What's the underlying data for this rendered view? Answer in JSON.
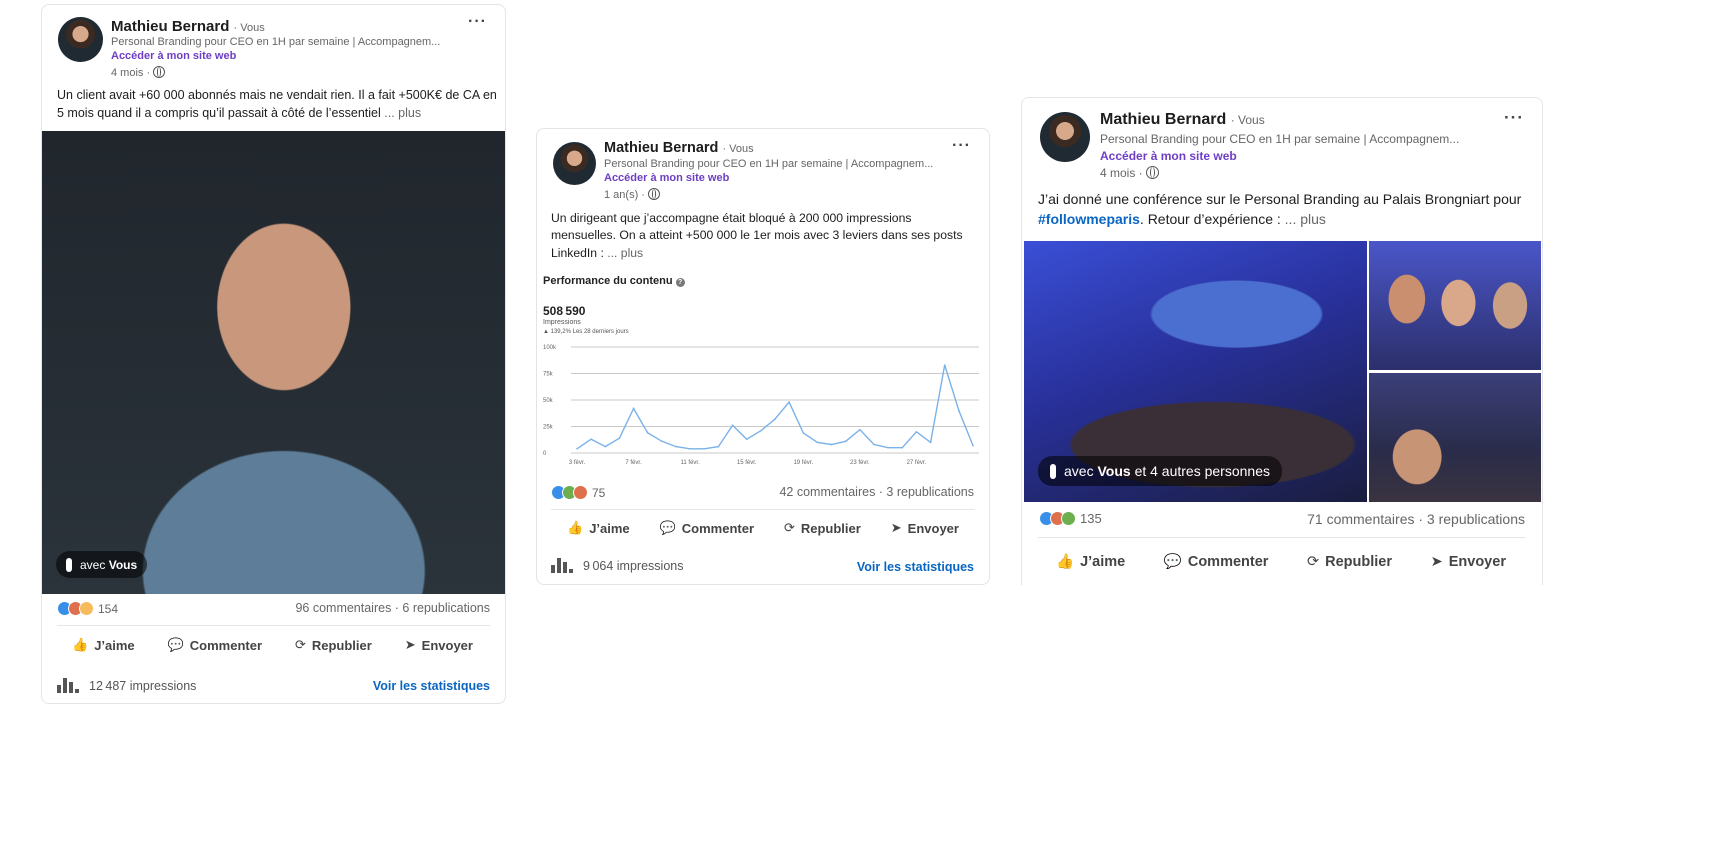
{
  "author": {
    "name": "Mathieu Bernard",
    "badge": "· Vous",
    "headline": "Personal Branding pour CEO en 1H par semaine | Accompagnem...",
    "website_link": "Accéder à mon site web"
  },
  "posts": [
    {
      "age": "4 mois ·",
      "text": "Un client avait +60 000 abonnés mais ne vendait rien. Il a fait +500K€ de CA en 5 mois quand il a compris qu’il passait à côté de l’essentiel",
      "more": "... plus",
      "tag_prefix": "avec",
      "tag_bold": "Vous",
      "reactions": "154",
      "stats": "96 commentaires · 6 republications",
      "impressions": "12 487 impressions"
    },
    {
      "age": "1 an(s) ·",
      "text": "Un dirigeant que j’accompagne était bloqué à 200 000 impressions mensuelles. On a atteint +500 000 le 1er mois avec 3 leviers dans ses posts LinkedIn :",
      "more": "... plus",
      "perf_title": "Performance du contenu",
      "perf_value": "508 590",
      "perf_label": "Impressions",
      "perf_change": "▲ 139,2% Les 28 derniers jours",
      "reactions": "75",
      "stats": "42 commentaires · 3 republications",
      "impressions": "9 064 impressions"
    },
    {
      "age": "4 mois ·",
      "text_before": "J’ai donné une conférence sur le Personal Branding au Palais Brongniart pour",
      "hashtag": "#followmeparis",
      "text_after": ". Retour d’expérience :",
      "more": "... plus",
      "tag_prefix": "avec",
      "tag_bold": "Vous",
      "tag_suffix": "et 4 autres personnes",
      "reactions": "135",
      "stats": "71 commentaires · 3 republications"
    }
  ],
  "actions": {
    "like": "J’aime",
    "comment": "Commenter",
    "repost": "Republier",
    "send": "Envoyer"
  },
  "statistics_link": "Voir les statistiques",
  "menu_glyph": "···",
  "icons": {
    "like": "thumbs-up-icon",
    "comment": "comment-bubble-icon",
    "repost": "repost-arrows-icon",
    "send": "send-plane-icon",
    "visibility": "globe-icon",
    "impressions": "bar-chart-icon"
  },
  "colors": {
    "link_purple": "#6e3fc4",
    "link_blue": "#0a66c2",
    "chart_line": "#7ab2e8"
  },
  "chart_data": {
    "type": "line",
    "x": [
      "3 févr.",
      "4 févr.",
      "5 févr.",
      "6 févr.",
      "7 févr.",
      "8 févr.",
      "9 févr.",
      "10 févr.",
      "11 févr.",
      "12 févr.",
      "13 févr.",
      "14 févr.",
      "15 févr.",
      "16 févr.",
      "17 févr.",
      "18 févr.",
      "19 févr.",
      "20 févr.",
      "21 févr.",
      "22 févr.",
      "23 févr.",
      "24 févr.",
      "25 févr.",
      "26 févr.",
      "27 févr.",
      "28 févr.",
      "1 mars",
      "2 mars"
    ],
    "values": [
      4000,
      13000,
      6000,
      14000,
      42000,
      19000,
      11000,
      6000,
      4000,
      4000,
      6000,
      26000,
      13000,
      21000,
      32000,
      48000,
      19000,
      10000,
      8000,
      11000,
      22000,
      8000,
      5000,
      5000,
      20000,
      10000,
      83000,
      40000,
      7000
    ],
    "y_ticks": [
      "0",
      "25k",
      "50k",
      "75k",
      "100k"
    ],
    "x_tick_labels": [
      "3 févr.",
      "7 févr.",
      "11 févr.",
      "15 févr.",
      "19 févr.",
      "23 févr.",
      "27 févr."
    ],
    "ylim": [
      0,
      100000
    ],
    "grid": true
  }
}
